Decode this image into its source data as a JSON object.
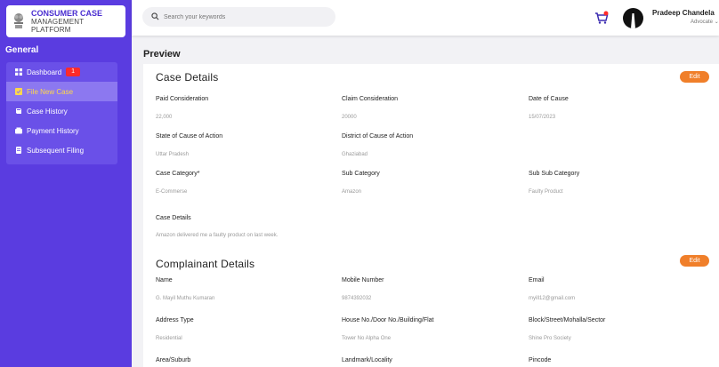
{
  "brand": {
    "line1": "CONSUMER CASE",
    "line2": "MANAGEMENT",
    "line3": "PLATFORM"
  },
  "sidebar": {
    "heading": "General",
    "items": [
      {
        "label": "Dashboard",
        "icon": "grid-icon",
        "badge": "1"
      },
      {
        "label": "File New Case",
        "icon": "file-icon",
        "active": true
      },
      {
        "label": "Case History",
        "icon": "book-icon"
      },
      {
        "label": "Payment History",
        "icon": "wallet-icon"
      },
      {
        "label": "Subsequent Filing",
        "icon": "document-icon"
      }
    ]
  },
  "topbar": {
    "search_placeholder": "Search your keywords",
    "user_name": "Pradeep Chandela",
    "user_role": "Advocate"
  },
  "page": {
    "title": "Preview"
  },
  "case_details": {
    "title": "Case Details",
    "edit_label": "Edit",
    "fields": [
      {
        "label": "Paid Consideration",
        "value": "22,000"
      },
      {
        "label": "Claim Consideration",
        "value": "20000"
      },
      {
        "label": "Date of Cause",
        "value": "15/07/2023"
      },
      {
        "label": "State of Cause of Action",
        "value": "Uttar Pradesh"
      },
      {
        "label": "District of Cause of Action",
        "value": "Ghaziabad"
      },
      {
        "label": "Case Category*",
        "value": "E-Commerse"
      },
      {
        "label": "Sub Category",
        "value": "Amazon"
      },
      {
        "label": "Sub Sub Category",
        "value": "Faulty Product"
      },
      {
        "label": "Case Details",
        "value": "Amazon delivered me a faulty product on last week."
      }
    ]
  },
  "complainant_details": {
    "title": "Complainant Details",
    "edit_label": "Edit",
    "fields": [
      {
        "label": "Name",
        "value": "G. Mayil Muthu Kumaran"
      },
      {
        "label": "Mobile Number",
        "value": "9874392032"
      },
      {
        "label": "Email",
        "value": "myill12@gmail.com"
      },
      {
        "label": "Address Type",
        "value": "Residential"
      },
      {
        "label": "House No./Door No./Building/Flat",
        "value": "Tower No Alpha One"
      },
      {
        "label": "Block/Street/Mohalla/Sector",
        "value": "Shine Pro Society"
      },
      {
        "label": "Area/Suburb",
        "value": ""
      },
      {
        "label": "Landmark/Locality",
        "value": ""
      },
      {
        "label": "Pincode",
        "value": ""
      }
    ]
  },
  "colors": {
    "sidebar": "#5a3ce0",
    "accent": "#f07f2a",
    "badge": "#ff2a2a",
    "active_text": "#ffd84a"
  }
}
